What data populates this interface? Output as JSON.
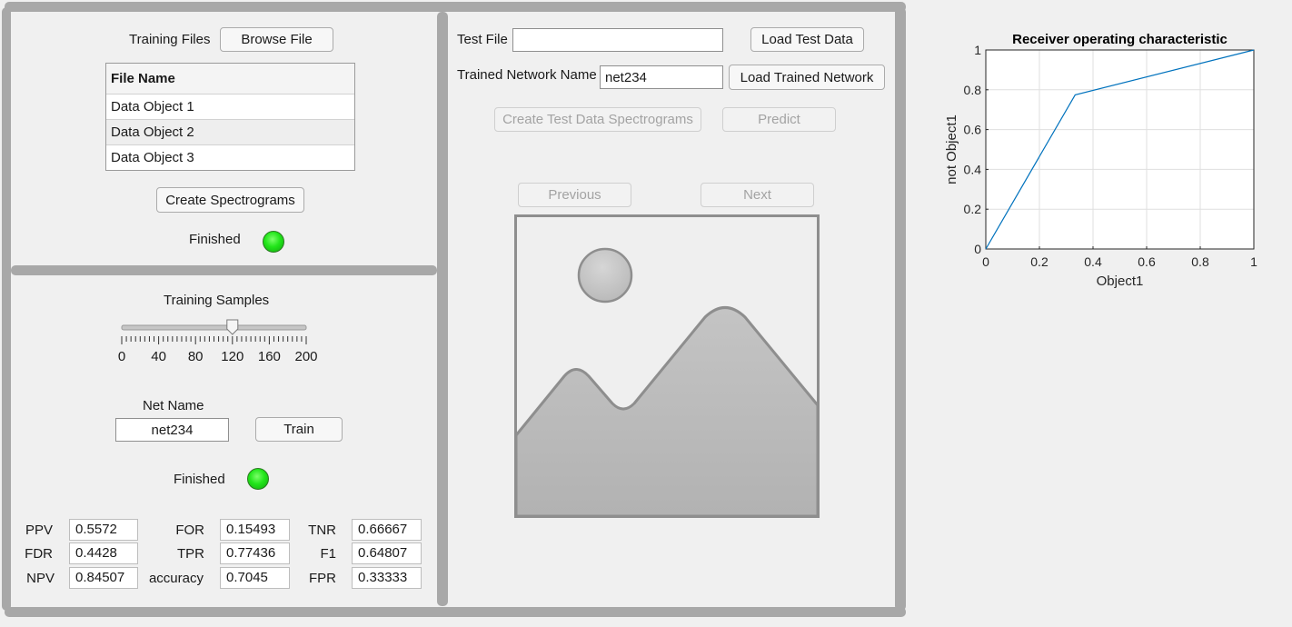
{
  "training": {
    "files_label": "Training Files",
    "browse_button": "Browse File",
    "table_header": "File Name",
    "files": [
      "Data Object 1",
      "Data Object 2",
      "Data Object 3"
    ],
    "create_spectrograms_button": "Create Spectrograms",
    "status_label": "Finished"
  },
  "samples": {
    "label": "Training Samples",
    "slider_value": 120,
    "slider_ticks": [
      "0",
      "40",
      "80",
      "120",
      "160",
      "200"
    ],
    "net_name_label": "Net Name",
    "net_name_value": "net234",
    "train_button": "Train",
    "status_label": "Finished"
  },
  "metrics": [
    {
      "label": "PPV",
      "value": "0.5572"
    },
    {
      "label": "FDR",
      "value": "0.4428"
    },
    {
      "label": "NPV",
      "value": "0.84507"
    },
    {
      "label": "FOR",
      "value": "0.15493"
    },
    {
      "label": "TPR",
      "value": "0.77436"
    },
    {
      "label": "accuracy",
      "value": "0.7045"
    },
    {
      "label": "TNR",
      "value": "0.66667"
    },
    {
      "label": "F1",
      "value": "0.64807"
    },
    {
      "label": "FPR",
      "value": "0.33333"
    }
  ],
  "test": {
    "file_label": "Test File",
    "file_value": "",
    "load_test_button": "Load Test Data",
    "network_label": "Trained Network Name",
    "network_value": "net234",
    "load_network_button": "Load Trained Network",
    "create_test_button": "Create Test Data Spectrograms",
    "predict_button": "Predict",
    "previous_button": "Previous",
    "next_button": "Next",
    "image_placeholder_icon": "image-placeholder-icon"
  },
  "chart_data": {
    "type": "line",
    "title": "Receiver operating characteristic",
    "xlabel": "Object1",
    "ylabel": "not Object1",
    "xlim": [
      0,
      1
    ],
    "ylim": [
      0,
      1
    ],
    "xticks": [
      "0",
      "0.2",
      "0.4",
      "0.6",
      "0.8",
      "1"
    ],
    "yticks": [
      "0",
      "0.2",
      "0.4",
      "0.6",
      "0.8",
      "1"
    ],
    "grid": true,
    "series": [
      {
        "x": [
          0,
          0.33333,
          1
        ],
        "y": [
          0,
          0.77436,
          1
        ],
        "color": "#0072bd"
      }
    ]
  }
}
